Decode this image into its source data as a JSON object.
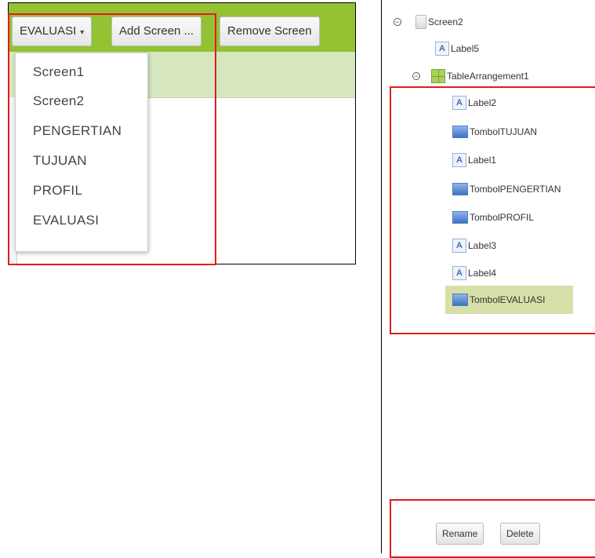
{
  "toolbar": {
    "screen_select_label": "EVALUASI",
    "screen_select_caret": "▾",
    "add_screen_label": "Add Screen ...",
    "remove_screen_label": "Remove Screen"
  },
  "screen_dropdown": {
    "items": [
      "Screen1",
      "Screen2",
      "PENGERTIAN",
      "TUJUAN",
      "PROFIL",
      "EVALUASI"
    ]
  },
  "component_tree": {
    "root": {
      "label": "Screen2",
      "toggle": "−",
      "icon": "screen-icon"
    },
    "top_children": [
      {
        "label": "Label5",
        "icon": "label-icon"
      }
    ],
    "arrangement": {
      "label": "TableArrangement1",
      "toggle": "−",
      "icon": "table-arrangement-icon"
    },
    "arrangement_children": [
      {
        "label": "Label2",
        "icon": "label-icon"
      },
      {
        "label": "TombolTUJUAN",
        "icon": "button-icon"
      },
      {
        "label": "Label1",
        "icon": "label-icon"
      },
      {
        "label": "TombolPENGERTIAN",
        "icon": "button-icon"
      },
      {
        "label": "TombolPROFIL",
        "icon": "button-icon"
      },
      {
        "label": "Label3",
        "icon": "label-icon"
      },
      {
        "label": "Label4",
        "icon": "label-icon"
      },
      {
        "label": "TombolEVALUASI",
        "icon": "button-icon"
      }
    ],
    "selected": "TombolEVALUASI"
  },
  "actions": {
    "rename_label": "Rename",
    "delete_label": "Delete"
  },
  "colors": {
    "toolbar_green": "#93c233",
    "highlight_red": "#e21b1b",
    "selection": "#d6e0a8"
  }
}
